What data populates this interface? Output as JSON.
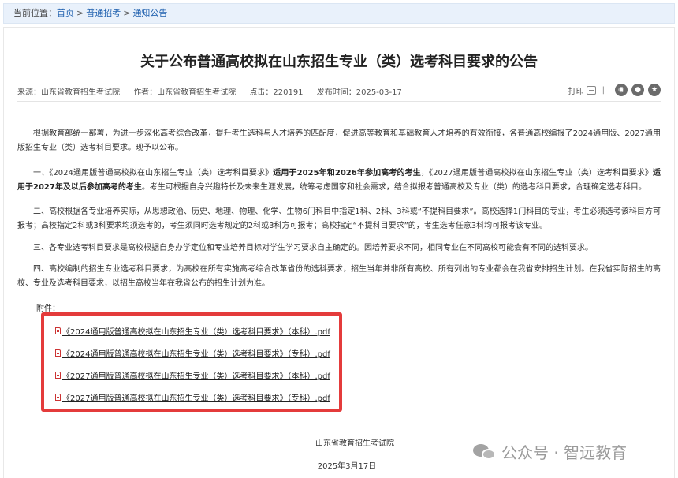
{
  "breadcrumb": {
    "prefix": "当前位置：",
    "items": [
      "首页",
      "普通招考",
      "通知公告"
    ],
    "sep": ">"
  },
  "article": {
    "title": "关于公布普通高校拟在山东招生专业（类）选考科目要求的公告",
    "meta": {
      "source": "来源：山东省教育招生考试院",
      "author": "作者：山东省教育招生考试院",
      "hits": "点击：220191",
      "date": "发布时间：2025-03-17"
    },
    "tools": {
      "print": "打印",
      "divider": "|"
    },
    "p1": "根据教育部统一部署，为进一步深化高考综合改革，提升考生选科与人才培养的匹配度，促进高等教育和基础教育人才培养的有效衔接，各普通高校编报了2024通用版、2027通用版招生专业（类）选考科目要求。现予以公布。",
    "p2a": "一、《2024通用版普通高校拟在山东招生专业（类）选考科目要求》",
    "p2b": "适用于2025年和2026年参加高考的考生",
    "p2c": "，《2027通用版普通高校拟在山东招生专业（类）选考科目要求》",
    "p2d": "适用于2027年及以后参加高考的考生",
    "p2e": "。考生可根据自身兴趣特长及未来生涯发展，统筹考虑国家和社会需求，结合拟报考普通高校及专业（类）的选考科目要求，合理确定选考科目。",
    "p3": "二、高校根据各专业培养实际，从思想政治、历史、地理、物理、化学、生物6门科目中指定1科、2科、3科或“不提科目要求”。高校选择1门科目的专业，考生必须选考该科目方可报考；高校指定2科或3科要求均须选考的，考生须同时选考规定的2科或3科方可报考；高校指定“不提科目要求”的，考生选考任意3科均可报考该专业。",
    "p4": "三、各专业选考科目要求是高校根据自身办学定位和专业培养目标对学生学习要求自主确定的。因培养要求不同，相同专业在不同高校可能会有不同的选科要求。",
    "p5": "四、高校编制的招生专业选考科目要求，为高校在所有实施高考综合改革省份的选科要求，招生当年并非所有高校、所有列出的专业都会在我省安排招生计划。在我省实际招生的高校、专业及选考科目要求，以招生高校当年在我省公布的招生计划为准。",
    "attach_label": "附件：",
    "attachments": [
      "《2024通用版普通高校拟在山东招生专业（类）选考科目要求》（本科）.pdf",
      "《2024通用版普通高校拟在山东招生专业（类）选考科目要求》（专科）.pdf",
      "《2027通用版普通高校拟在山东招生专业（类）选考科目要求》（本科）.pdf",
      "《2027通用版普通高校拟在山东招生专业（类）选考科目要求》（专科）.pdf"
    ],
    "sign_org": "山东省教育招生考试院",
    "sign_date": "2025年3月17日"
  },
  "watermark": {
    "text": "公众号 · 智远教育"
  },
  "colors": {
    "highlight_border": "#e43b3b",
    "link": "#1d5fae",
    "breadcrumb_bg": "#e9f1fb"
  },
  "icons": [
    "print-icon",
    "weibo-share-icon",
    "wechat-share-icon",
    "qzone-share-icon",
    "pdf-icon",
    "wechat-logo-icon"
  ]
}
